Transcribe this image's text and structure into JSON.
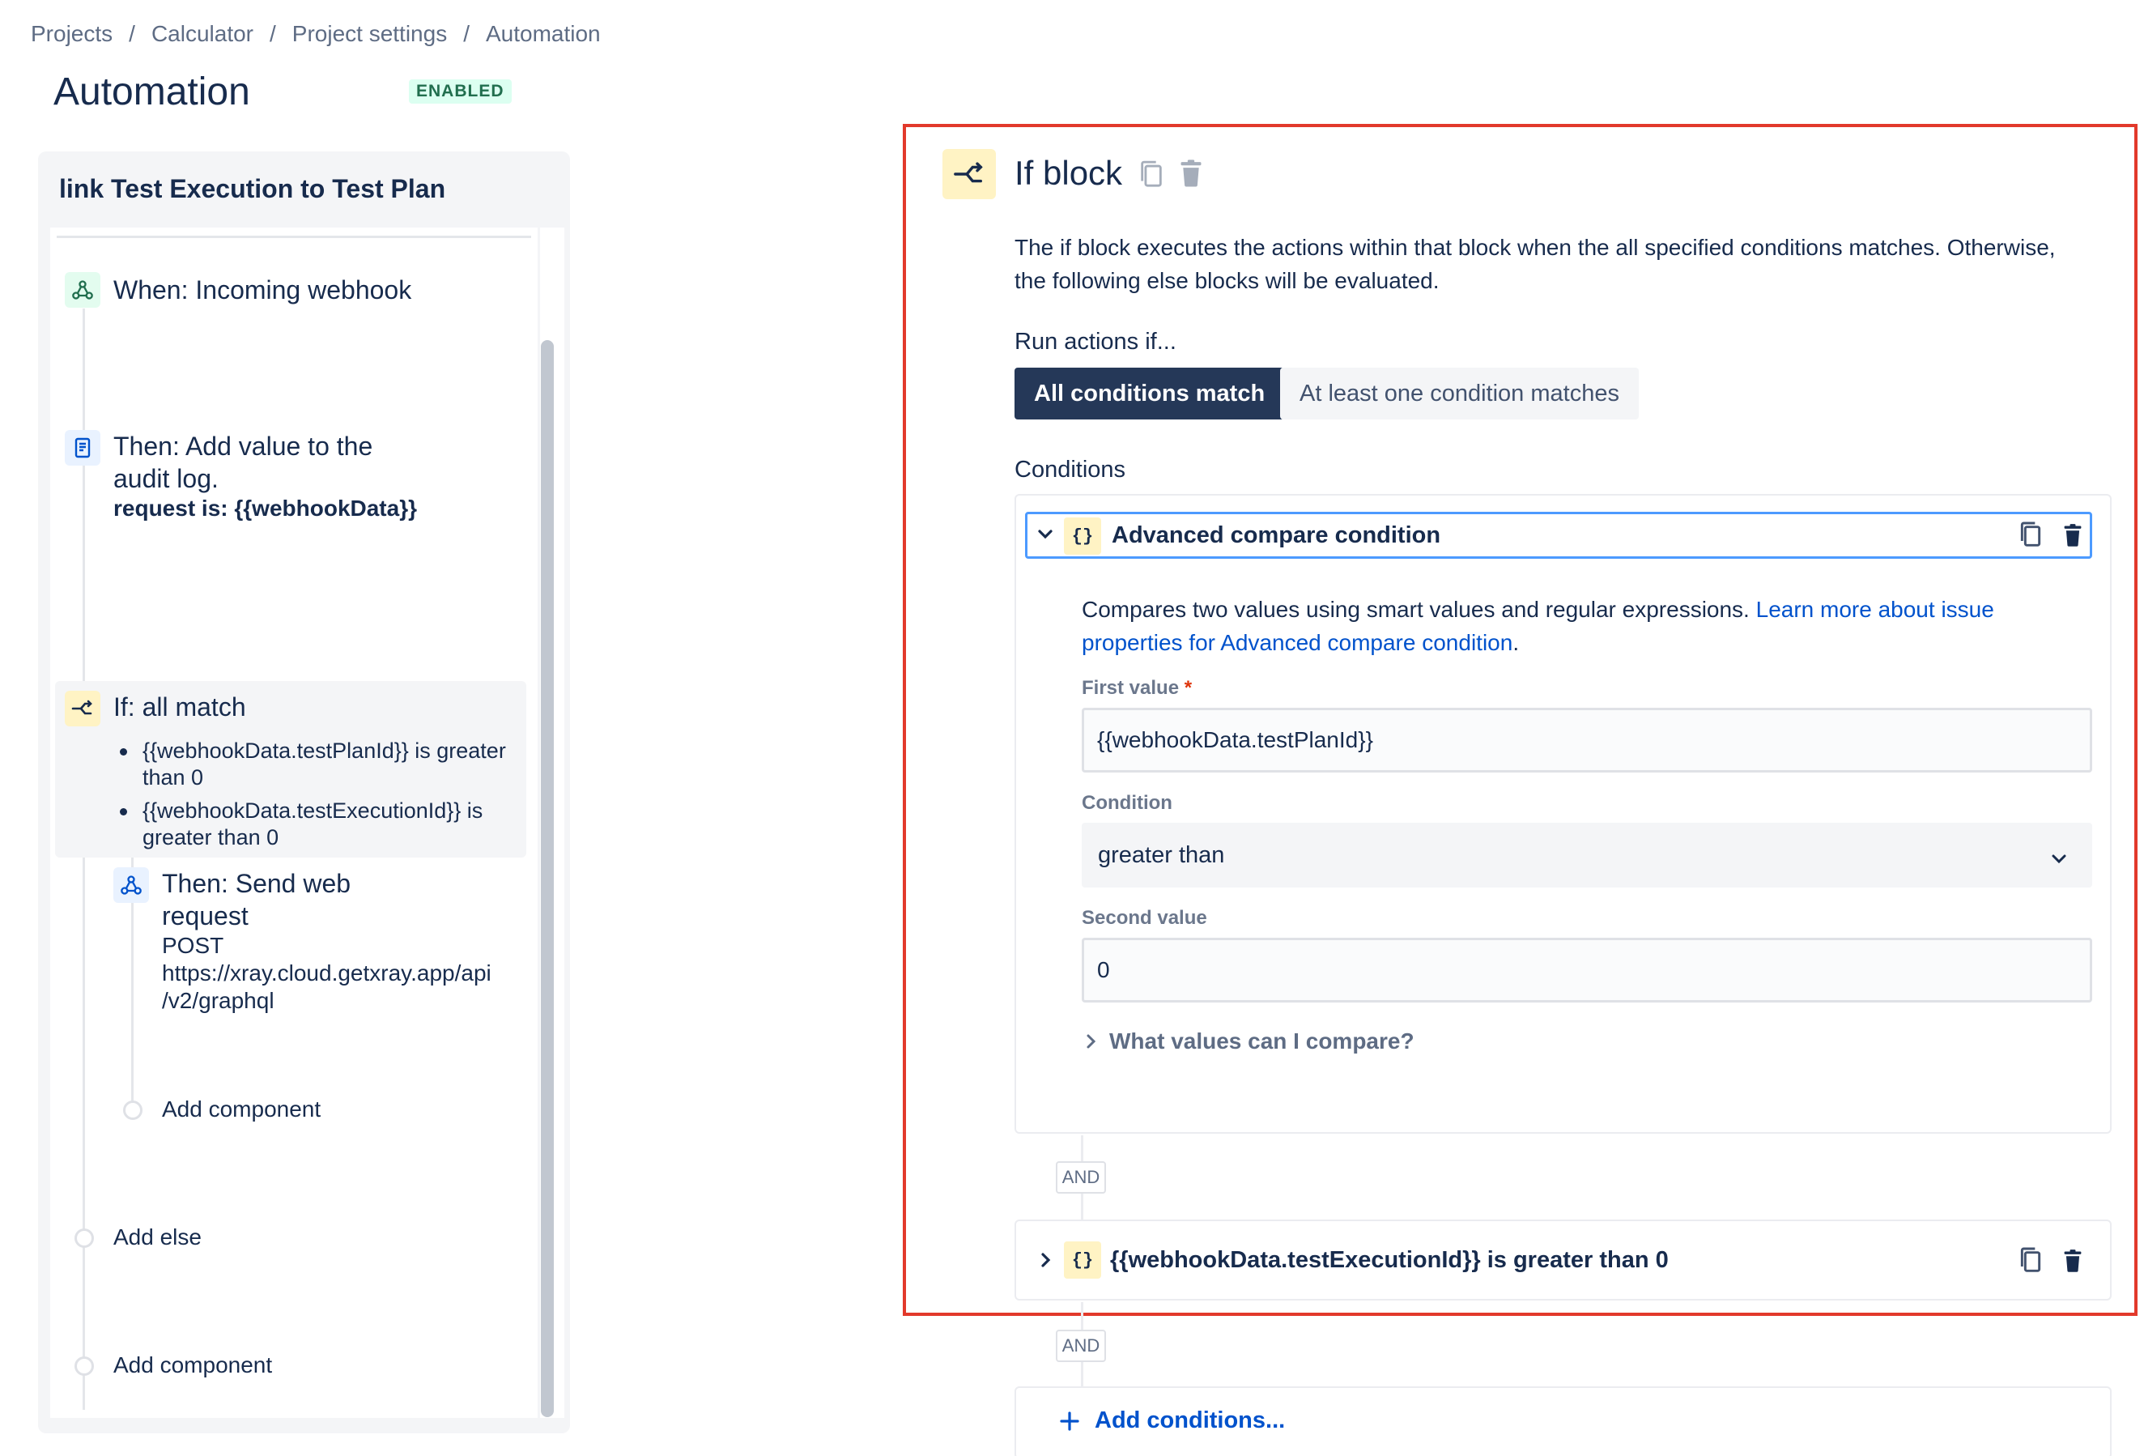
{
  "breadcrumb": {
    "items": [
      "Projects",
      "Calculator",
      "Project settings",
      "Automation"
    ],
    "separator": "/"
  },
  "page": {
    "title": "Automation",
    "status": "ENABLED"
  },
  "rule": {
    "name": "link Test Execution to Test Plan",
    "trigger": {
      "label": "When: Incoming webhook",
      "icon": "webhook-icon"
    },
    "action_audit": {
      "line1": "Then: Add value to the",
      "line2": "audit log.",
      "detail": "request is: {{webhookData}}",
      "icon": "document-icon"
    },
    "if_block": {
      "label": "If: all match",
      "icon": "branch-icon",
      "conditions": [
        "{{webhookData.testPlanId}} is greater than 0",
        "{{webhookData.testExecutionId}} is greater than 0"
      ]
    },
    "action_web": {
      "line1": "Then: Send web",
      "line2": "request",
      "method": "POST",
      "url1": "https://xray.cloud.getxray.app/api",
      "url2": "/v2/graphql",
      "icon": "webhook-icon"
    },
    "add_component_inner": "Add component",
    "add_else": "Add else",
    "add_component": "Add component"
  },
  "editor": {
    "title": "If block",
    "description": "The if block executes the actions within that block when the all specified conditions matches. Otherwise, the following else blocks will be evaluated.",
    "run_label": "Run actions if...",
    "mode_all": "All conditions match",
    "mode_any": "At least one condition matches",
    "conditions_label": "Conditions",
    "condition1": {
      "title": "Advanced compare condition",
      "icon_glyph": "{}",
      "description": "Compares two values using smart values and regular expressions. ",
      "link_text": "Learn more about issue properties for Advanced compare condition",
      "link_suffix": ".",
      "first_value_label": "First value",
      "required_mark": "*",
      "first_value": "{{webhookData.testPlanId}}",
      "condition_label": "Condition",
      "condition_value": "greater than",
      "second_value_label": "Second value",
      "second_value": "0",
      "help_toggle": "What values can I compare?"
    },
    "and_label": "AND",
    "condition2": {
      "title": "{{webhookData.testExecutionId}} is greater than 0",
      "icon_glyph": "{}"
    },
    "and_label2": "AND",
    "add_conditions": "Add conditions..."
  },
  "colors": {
    "highlight_border": "#e2392b",
    "primary_dark": "#253858",
    "link": "#0052cc",
    "badge_green_bg": "#dcfff1",
    "badge_green_text": "#216e4e",
    "icon_yellow_bg": "#fff3c4"
  }
}
